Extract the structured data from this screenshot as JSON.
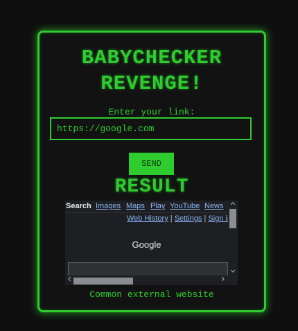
{
  "app": {
    "title_line1": "BABYCHECKER",
    "title_line2": "REVENGE!"
  },
  "form": {
    "link_label": "Enter your link:",
    "link_value": "https://google.com",
    "send_label": "SEND"
  },
  "result": {
    "heading": "RESULT",
    "caption": "Common external website",
    "preview": {
      "nav": {
        "active": "Search",
        "links": [
          "Images",
          "Maps",
          "Play",
          "YouTube",
          "News"
        ]
      },
      "sub_links": [
        "Web History",
        "Settings",
        "Sign in"
      ],
      "separator": "|",
      "logo_text": "Google",
      "scroll_up_icon": "chevron-up-icon",
      "scroll_down_icon": "chevron-down-icon",
      "scroll_left_icon": "chevron-left-icon",
      "scroll_right_icon": "chevron-right-icon"
    }
  },
  "colors": {
    "accent": "#2ecc2e",
    "background": "#0f0f0f",
    "card": "#121212",
    "preview_bg": "#1e1f22",
    "link": "#8ab4f8"
  }
}
